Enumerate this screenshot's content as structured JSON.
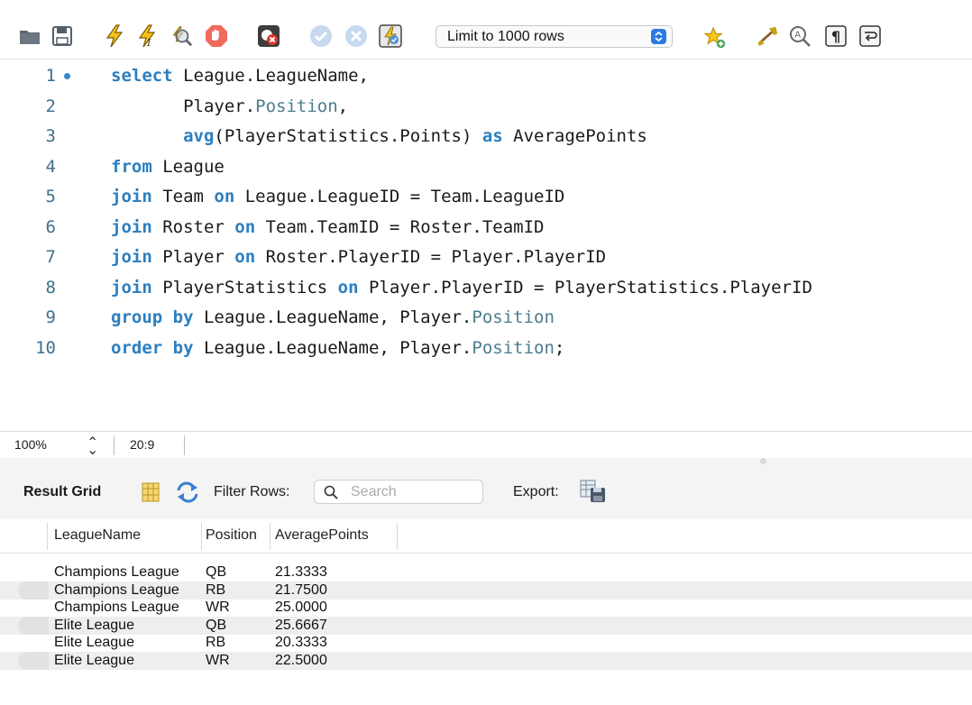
{
  "toolbar": {
    "limit_select": {
      "value": "Limit to 1000 rows"
    },
    "icons": [
      "folder-icon",
      "save-icon",
      "execute-icon",
      "execute-current-icon",
      "explain-icon",
      "stop-icon",
      "toggle-error-icon",
      "commit-icon",
      "rollback-icon",
      "autocommit-icon",
      "add-snippet-icon",
      "beautify-icon",
      "find-icon",
      "invisibles-icon",
      "wrap-icon"
    ]
  },
  "editor": {
    "lines": [
      {
        "num": "1",
        "parts": [
          {
            "t": "select",
            "k": "kw"
          },
          {
            "t": " League.LeagueName,",
            "k": ""
          }
        ]
      },
      {
        "num": "2",
        "parts": [
          {
            "t": "       Player.",
            "k": ""
          },
          {
            "t": "Position",
            "k": "mem"
          },
          {
            "t": ",",
            "k": ""
          }
        ]
      },
      {
        "num": "3",
        "parts": [
          {
            "t": "       ",
            "k": ""
          },
          {
            "t": "avg",
            "k": "kw"
          },
          {
            "t": "(PlayerStatistics.Points) ",
            "k": ""
          },
          {
            "t": "as",
            "k": "kw"
          },
          {
            "t": " AveragePoints",
            "k": ""
          }
        ]
      },
      {
        "num": "4",
        "parts": [
          {
            "t": "from",
            "k": "kw"
          },
          {
            "t": " League",
            "k": ""
          }
        ]
      },
      {
        "num": "5",
        "parts": [
          {
            "t": "join",
            "k": "kw"
          },
          {
            "t": " Team ",
            "k": ""
          },
          {
            "t": "on",
            "k": "kw"
          },
          {
            "t": " League.LeagueID = Team.LeagueID",
            "k": ""
          }
        ]
      },
      {
        "num": "6",
        "parts": [
          {
            "t": "join",
            "k": "kw"
          },
          {
            "t": " Roster ",
            "k": ""
          },
          {
            "t": "on",
            "k": "kw"
          },
          {
            "t": " Team.TeamID = Roster.TeamID",
            "k": ""
          }
        ]
      },
      {
        "num": "7",
        "parts": [
          {
            "t": "join",
            "k": "kw"
          },
          {
            "t": " Player ",
            "k": ""
          },
          {
            "t": "on",
            "k": "kw"
          },
          {
            "t": " Roster.PlayerID = Player.PlayerID",
            "k": ""
          }
        ]
      },
      {
        "num": "8",
        "parts": [
          {
            "t": "join",
            "k": "kw"
          },
          {
            "t": " PlayerStatistics ",
            "k": ""
          },
          {
            "t": "on",
            "k": "kw"
          },
          {
            "t": " Player.PlayerID = PlayerStatistics.PlayerID",
            "k": ""
          }
        ]
      },
      {
        "num": "9",
        "parts": [
          {
            "t": "group by",
            "k": "kw"
          },
          {
            "t": " League.LeagueName, Player.",
            "k": ""
          },
          {
            "t": "Position",
            "k": "mem"
          }
        ]
      },
      {
        "num": "10",
        "parts": [
          {
            "t": "order by",
            "k": "kw"
          },
          {
            "t": " League.LeagueName, Player.",
            "k": ""
          },
          {
            "t": "Position",
            "k": "mem"
          },
          {
            "t": ";",
            "k": ""
          }
        ]
      }
    ]
  },
  "statusbar": {
    "zoom": "100%",
    "cursor": "20:9"
  },
  "results": {
    "title": "Result Grid",
    "filter_label": "Filter Rows:",
    "search_placeholder": "Search",
    "export_label": "Export:",
    "columns": [
      "LeagueName",
      "Position",
      "AveragePoints"
    ],
    "rows": [
      [
        "Champions League",
        "QB",
        "21.3333"
      ],
      [
        "Champions League",
        "RB",
        "21.7500"
      ],
      [
        "Champions League",
        "WR",
        "25.0000"
      ],
      [
        "Elite League",
        "QB",
        "25.6667"
      ],
      [
        "Elite League",
        "RB",
        "20.3333"
      ],
      [
        "Elite League",
        "WR",
        "22.5000"
      ]
    ]
  },
  "colors": {
    "keyword": "#2b7fc0",
    "member": "#4c7c8e",
    "line_number": "#3f6f8c",
    "accent": "#2b7be4"
  }
}
